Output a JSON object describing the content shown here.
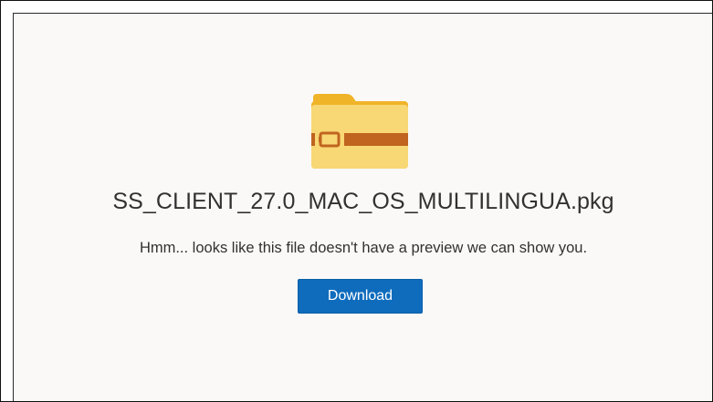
{
  "preview": {
    "file_name": "SS_CLIENT_27.0_MAC_OS_MULTILINGUA.pkg",
    "message": "Hmm... looks like this file doesn't have a preview we can show you.",
    "download_label": "Download",
    "icon": "folder-icon"
  },
  "colors": {
    "panel_background": "#faf9f8",
    "text": "#323130",
    "button_background": "#0f6cbd",
    "button_text": "#ffffff",
    "folder_body": "#f8d775",
    "folder_tab": "#f0b429",
    "folder_band": "#c0641f"
  }
}
